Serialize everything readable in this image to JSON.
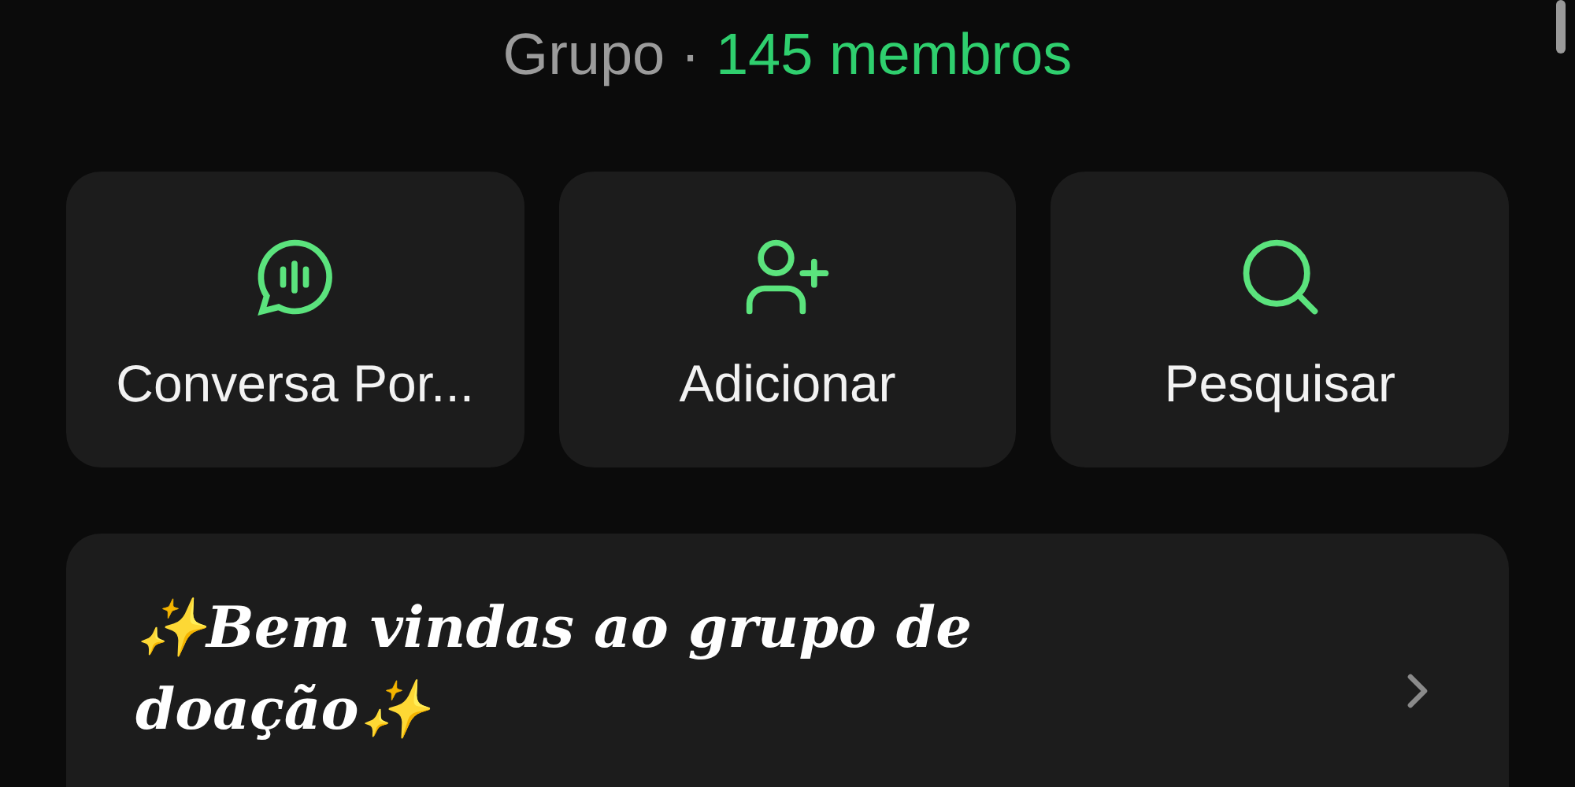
{
  "header": {
    "type": "Grupo",
    "separator": "·",
    "members": "145 membros"
  },
  "actions": [
    {
      "kind": "voice",
      "label": "Conversa Por..."
    },
    {
      "kind": "add",
      "label": "Adicionar"
    },
    {
      "kind": "search",
      "label": "Pesquisar"
    }
  ],
  "description": {
    "text": "✨Bem vindas ao grupo de doação✨"
  }
}
